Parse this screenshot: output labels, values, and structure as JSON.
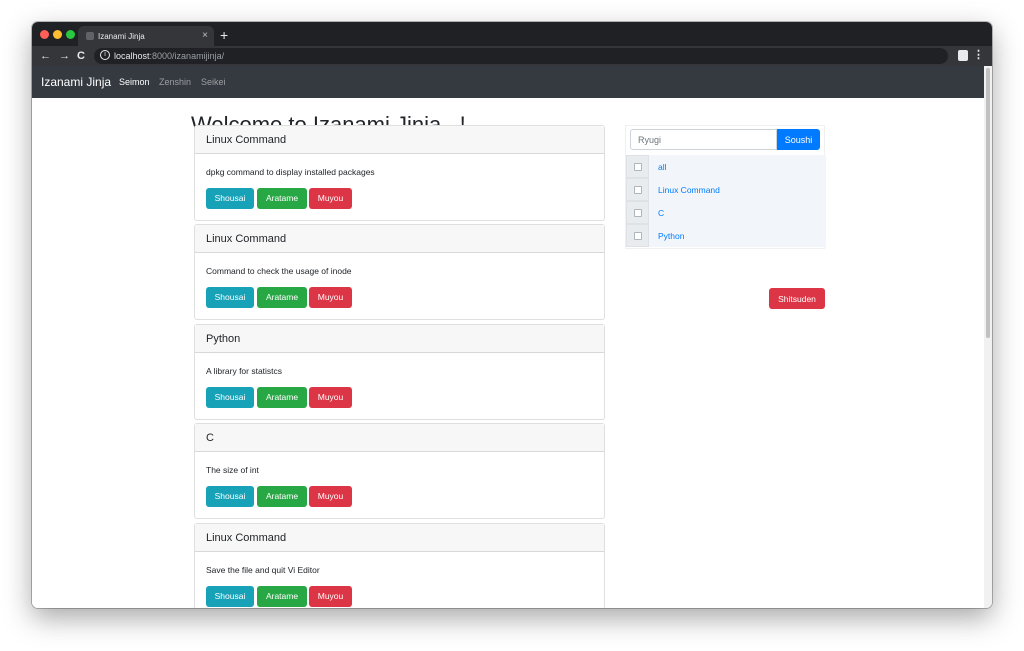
{
  "browser": {
    "tab_title": "Izanami Jinja",
    "tab_close": "×",
    "new_tab": "+",
    "url_host": "localhost",
    "url_path": ":8000/izanamijinja/",
    "back": "←",
    "forward": "→",
    "reload": "C",
    "info": "i",
    "menu": "⋮"
  },
  "navbar": {
    "brand": "Izanami Jinja",
    "links": [
      "Seimon",
      "Zenshin",
      "Seikei"
    ]
  },
  "main": {
    "title": "Welcome to Izanami Jinja...!"
  },
  "posts": [
    {
      "category": "Linux Command",
      "text": "dpkg command to display installed packages"
    },
    {
      "category": "Linux Command",
      "text": "Command to check the usage of inode"
    },
    {
      "category": "Python",
      "text": "A library for statistcs"
    },
    {
      "category": "C",
      "text": "The size of int"
    },
    {
      "category": "Linux Command",
      "text": "Save the file and quit Vi Editor"
    }
  ],
  "buttons": {
    "detail": "Shousai",
    "edit": "Aratame",
    "delete": "Muyou"
  },
  "sidebar": {
    "search_placeholder": "Ryugi",
    "search_button": "Soushi",
    "tags": [
      "all",
      "Linux Command",
      "C",
      "Python"
    ],
    "delete_button": "Shitsuden"
  },
  "colors": {
    "navbar": "#343a40",
    "info": "#17a2b8",
    "success": "#28a745",
    "danger": "#dc3545",
    "primary": "#007bff"
  }
}
